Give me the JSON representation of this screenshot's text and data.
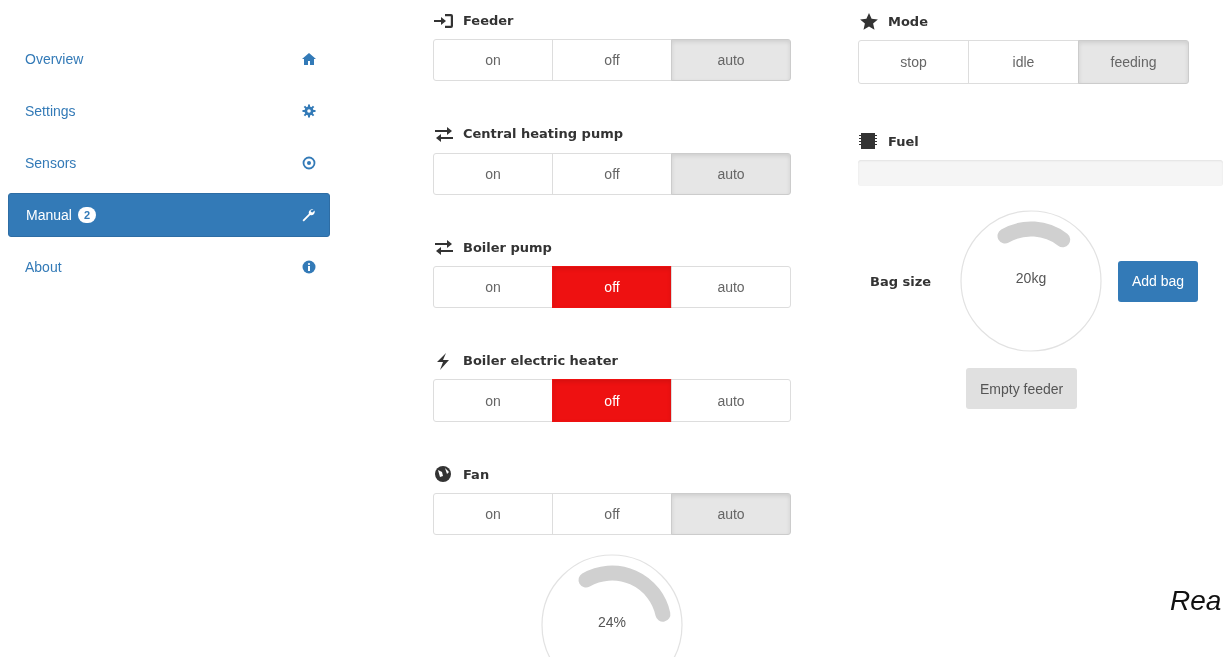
{
  "sidebar": {
    "items": [
      {
        "label": "Overview",
        "selected": false
      },
      {
        "label": "Settings",
        "selected": false
      },
      {
        "label": "Sensors",
        "selected": false
      },
      {
        "label": "Manual",
        "badge": "2",
        "selected": true
      },
      {
        "label": "About",
        "selected": false
      }
    ]
  },
  "controls": [
    {
      "title": "Feeder",
      "danger": false,
      "options": [
        {
          "label": "on",
          "selected": false
        },
        {
          "label": "off",
          "selected": false
        },
        {
          "label": "auto",
          "selected": true
        }
      ]
    },
    {
      "title": "Central heating pump",
      "danger": false,
      "options": [
        {
          "label": "on",
          "selected": false
        },
        {
          "label": "off",
          "selected": false
        },
        {
          "label": "auto",
          "selected": true
        }
      ]
    },
    {
      "title": "Boiler pump",
      "danger": true,
      "options": [
        {
          "label": "on",
          "selected": false
        },
        {
          "label": "off",
          "selected": true
        },
        {
          "label": "auto",
          "selected": false
        }
      ]
    },
    {
      "title": "Boiler electric heater",
      "danger": true,
      "options": [
        {
          "label": "on",
          "selected": false
        },
        {
          "label": "off",
          "selected": true
        },
        {
          "label": "auto",
          "selected": false
        }
      ]
    },
    {
      "title": "Fan",
      "danger": false,
      "options": [
        {
          "label": "on",
          "selected": false
        },
        {
          "label": "off",
          "selected": false
        },
        {
          "label": "auto",
          "selected": true
        }
      ],
      "knob": {
        "reading": "24%"
      }
    }
  ],
  "mode": {
    "title": "Mode",
    "options": [
      {
        "label": "stop",
        "selected": false
      },
      {
        "label": "idle",
        "selected": false
      },
      {
        "label": "feeding",
        "selected": true
      }
    ]
  },
  "fuel": {
    "title": "Fuel"
  },
  "bag": {
    "label": "Bag size",
    "reading": "20kg",
    "buttons": [
      {
        "label": "Add bag",
        "kind": "primary"
      },
      {
        "label": "Empty feeder",
        "kind": "secondary"
      }
    ]
  },
  "status_text": "Rea"
}
